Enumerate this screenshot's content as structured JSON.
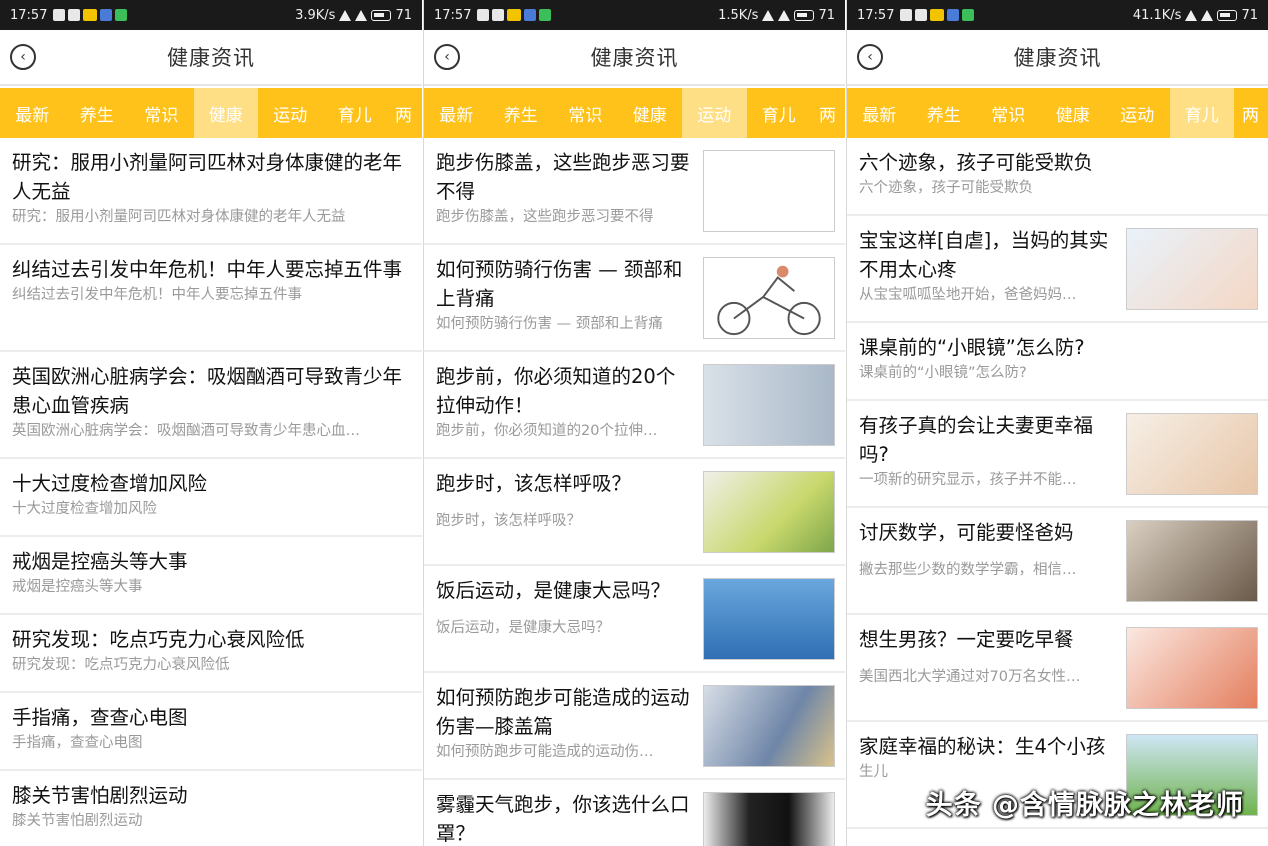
{
  "panels": [
    {
      "status": {
        "time": "17:57",
        "speed": "3.9K/s",
        "battery": "71"
      },
      "header": {
        "title": "健康资讯",
        "back_icon": "‹"
      },
      "tabs": [
        "最新",
        "养生",
        "常识",
        "健康",
        "运动",
        "育儿",
        "两"
      ],
      "active_tab_index": 3,
      "items": [
        {
          "title": "研究：服用小剂量阿司匹林对身体康健的老年人无益",
          "summary": "研究：服用小剂量阿司匹林对身体康健的老年人无益"
        },
        {
          "title": "纠结过去引发中年危机！中年人要忘掉五件事",
          "summary": "纠结过去引发中年危机！中年人要忘掉五件事"
        },
        {
          "title": "英国欧洲心脏病学会：吸烟酗酒可导致青少年患心血管疾病",
          "summary": "英国欧洲心脏病学会：吸烟酗酒可导致青少年患心血…"
        },
        {
          "title": "十大过度检查增加风险",
          "summary": "十大过度检查增加风险"
        },
        {
          "title": "戒烟是控癌头等大事",
          "summary": "戒烟是控癌头等大事"
        },
        {
          "title": "研究发现：吃点巧克力心衰风险低",
          "summary": "研究发现：吃点巧克力心衰风险低"
        },
        {
          "title": "手指痛，查查心电图",
          "summary": "手指痛，查查心电图"
        },
        {
          "title": "膝关节害怕剧烈运动",
          "summary": "膝关节害怕剧烈运动"
        }
      ]
    },
    {
      "status": {
        "time": "17:57",
        "speed": "1.5K/s",
        "battery": "71"
      },
      "header": {
        "title": "健康资讯",
        "back_icon": "‹"
      },
      "tabs": [
        "最新",
        "养生",
        "常识",
        "健康",
        "运动",
        "育儿",
        "两"
      ],
      "active_tab_index": 4,
      "items": [
        {
          "title": "跑步伤膝盖，这些跑步恶习要不得",
          "summary": "跑步伤膝盖，这些跑步恶习要不得",
          "thumb": "blank"
        },
        {
          "title": "如何预防骑行伤害 — 颈部和上背痛",
          "summary": "如何预防骑行伤害 — 颈部和上背痛",
          "thumb": "bike"
        },
        {
          "title": "跑步前，你必须知道的20个拉伸动作！",
          "summary": "跑步前，你必须知道的20个拉伸…",
          "thumb": "stretch"
        },
        {
          "title": "跑步时，该怎样呼吸？",
          "summary": "跑步时，该怎样呼吸？",
          "thumb": "breath"
        },
        {
          "title": "饭后运动，是健康大忌吗？",
          "summary": "饭后运动，是健康大忌吗？",
          "thumb": "thinker"
        },
        {
          "title": "如何预防跑步可能造成的运动伤害—膝盖篇",
          "summary": "如何预防跑步可能造成的运动伤…",
          "thumb": "knee"
        },
        {
          "title": "雾霾天气跑步，你该选什么口罩？",
          "summary": "",
          "thumb": "mask"
        }
      ]
    },
    {
      "status": {
        "time": "17:57",
        "speed": "41.1K/s",
        "battery": "71"
      },
      "header": {
        "title": "健康资讯",
        "back_icon": "‹"
      },
      "tabs": [
        "最新",
        "养生",
        "常识",
        "健康",
        "运动",
        "育儿",
        "两"
      ],
      "active_tab_index": 5,
      "items": [
        {
          "title": "六个迹象，孩子可能受欺负",
          "summary": "六个迹象，孩子可能受欺负"
        },
        {
          "title": "宝宝这样[自虐]，当妈的其实不用太心疼",
          "summary": "从宝宝呱呱坠地开始，爸爸妈妈…",
          "thumb": "baby1"
        },
        {
          "title": "课桌前的“小眼镜”怎么防?",
          "summary": "课桌前的“小眼镜”怎么防?"
        },
        {
          "title": "有孩子真的会让夫妻更幸福吗?",
          "summary": "一项新的研究显示，孩子并不能…",
          "thumb": "girl"
        },
        {
          "title": "讨厌数学，可能要怪爸妈",
          "summary": "撇去那些少数的数学学霸，相信…",
          "thumb": "boy"
        },
        {
          "title": "想生男孩？一定要吃早餐",
          "summary": "美国西北大学通过对70万名女性…",
          "thumb": "preg"
        },
        {
          "title": "家庭幸福的秘诀：生4个小孩",
          "summary": "生儿",
          "thumb": "family"
        }
      ]
    }
  ],
  "watermark": "头条 @含情脉脉之林老师"
}
